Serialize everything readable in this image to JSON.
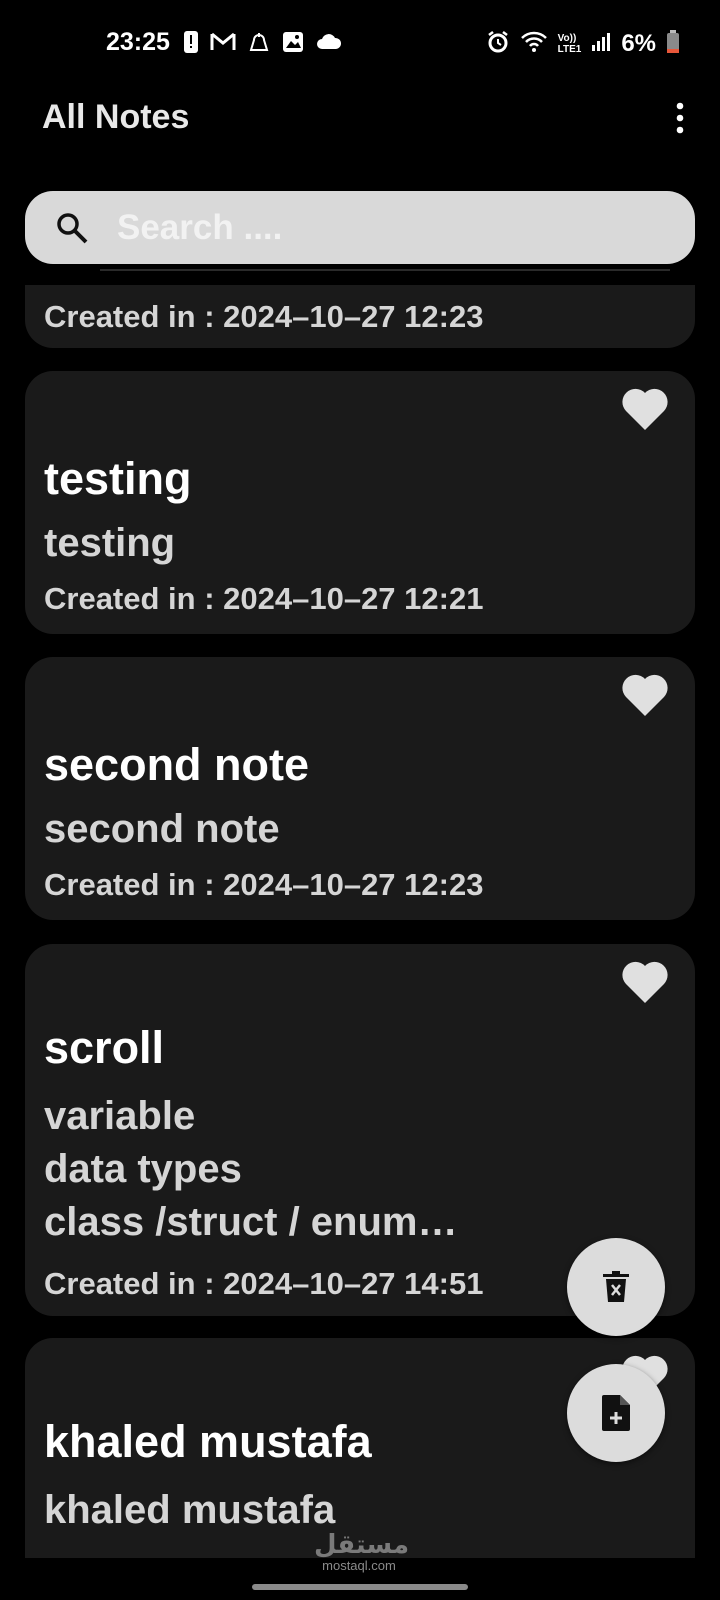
{
  "status_bar": {
    "time": "23:25",
    "battery_percent": "6%",
    "network_label_top": "Vo))",
    "network_label_bottom": "LTE1",
    "left_icons": [
      "alert-icon",
      "gmail-icon",
      "notification-icon",
      "gallery-icon",
      "cloud-icon"
    ],
    "right_icons": [
      "alarm-icon",
      "wifi-icon",
      "volte-icon",
      "signal-icon",
      "battery-icon"
    ]
  },
  "header": {
    "title": "All Notes",
    "menu_icon": "more-vert-icon"
  },
  "search": {
    "placeholder": "Search ....",
    "value": ""
  },
  "notes": [
    {
      "title": "",
      "body": [],
      "date": "Created in : 2024–10–27  12:23"
    },
    {
      "title": "testing",
      "body": [
        "testing"
      ],
      "date": "Created in : 2024–10–27  12:21"
    },
    {
      "title": "second note",
      "body": [
        "second note"
      ],
      "date": "Created in : 2024–10–27  12:23"
    },
    {
      "title": "scroll",
      "body": [
        "variable",
        "data types",
        "class /struct / enum…"
      ],
      "date": "Created in : 2024–10–27  14:51"
    },
    {
      "title": "khaled mustafa",
      "body": [
        "khaled mustafa"
      ],
      "date": ""
    }
  ],
  "fabs": {
    "delete_icon": "delete-icon",
    "add_icon": "add-note-icon"
  },
  "watermark": {
    "arabic": "مستقل",
    "latin": "mostaql.com"
  },
  "colors": {
    "background": "#000000",
    "card": "#1a1a1a",
    "search_bg": "#d9d9d9",
    "fab_bg": "#dcdcdc",
    "heart": "#e0e0e0"
  }
}
